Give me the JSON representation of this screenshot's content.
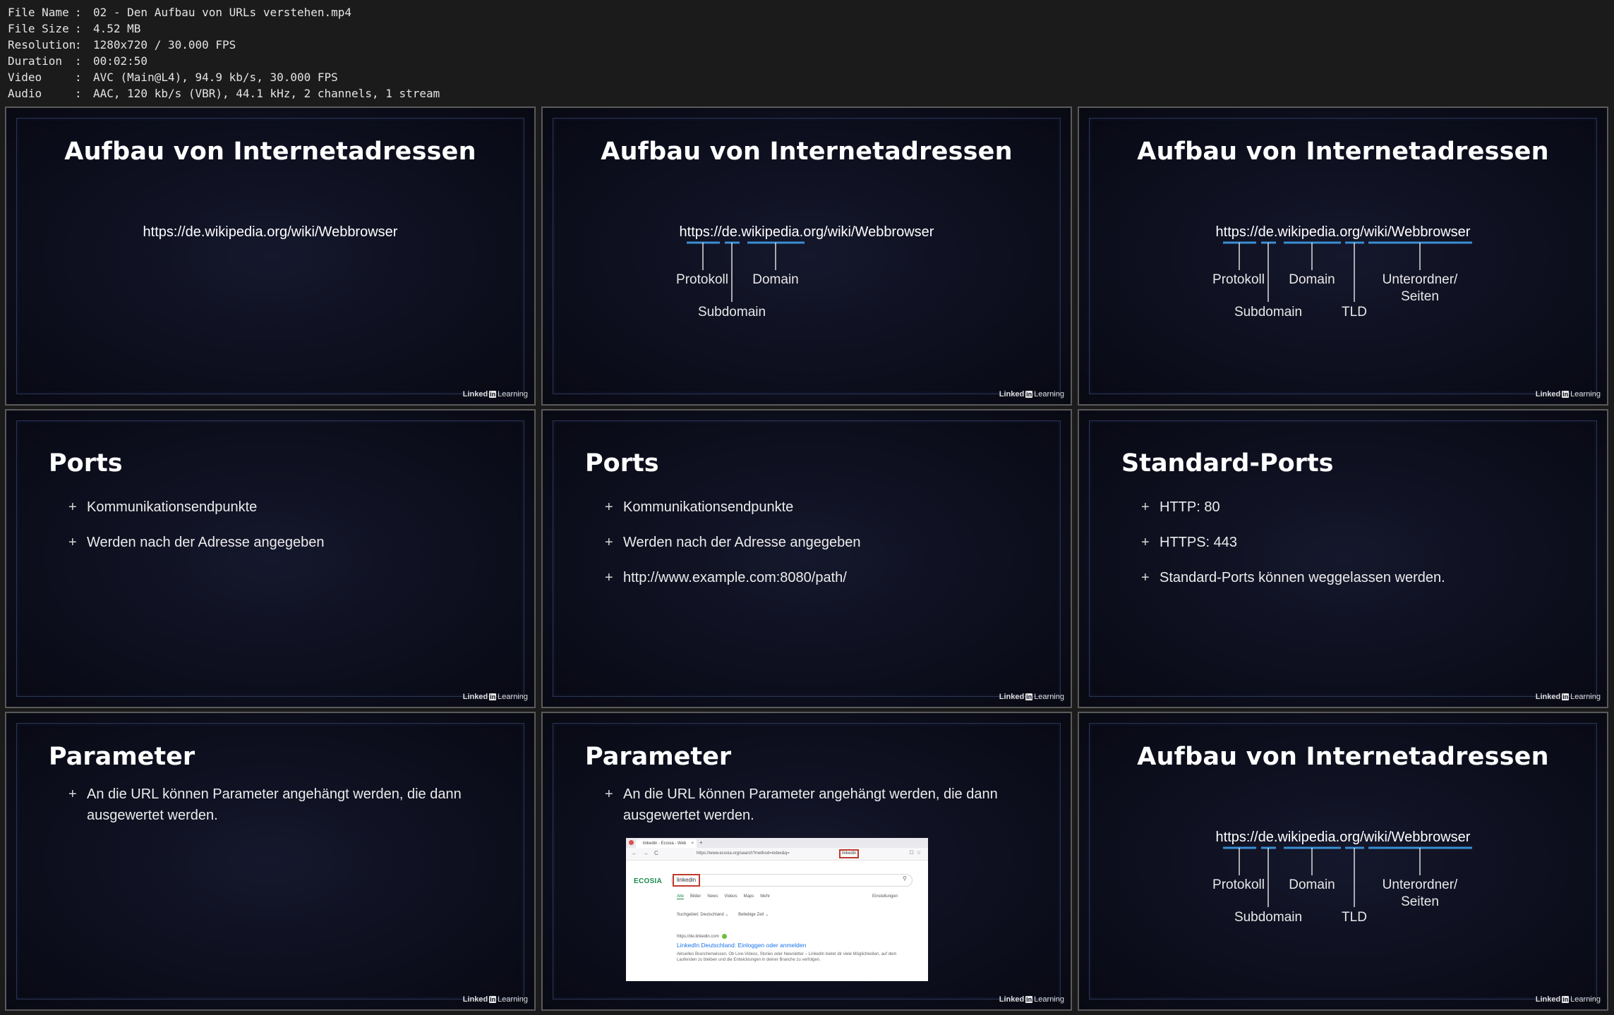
{
  "meta": [
    {
      "key": "File Name",
      "value": "02 - Den Aufbau von URLs verstehen.mp4"
    },
    {
      "key": "File Size",
      "value": "4.52 MB"
    },
    {
      "key": "Resolution",
      "value": "1280x720 / 30.000 FPS"
    },
    {
      "key": "Duration",
      "value": "00:02:50"
    },
    {
      "key": "Video",
      "value": "AVC (Main@L4), 94.9 kb/s, 30.000 FPS"
    },
    {
      "key": "Audio",
      "value": "AAC, 120 kb/s (VBR), 44.1 kHz, 2 channels, 1 stream"
    }
  ],
  "meta_separator": ":",
  "brand": {
    "part1": "Linked",
    "in": "in",
    "part2": "Learning"
  },
  "url_slide": {
    "title": "Aufbau von Internetadressen",
    "url": "https://de.wikipedia.org/wiki/Webbrowser",
    "labels": {
      "protokoll": "Protokoll",
      "subdomain": "Subdomain",
      "domain": "Domain",
      "tld": "TLD",
      "unterordner": "Unterordner/",
      "seiten": "Seiten"
    },
    "colors": {
      "underline": "#3a8fd4"
    }
  },
  "ports": {
    "title": "Ports",
    "bullets": [
      "Kommunikationsendpunkte",
      "Werden nach der Adresse angegeben",
      "http://www.example.com:8080/path/"
    ]
  },
  "standard_ports": {
    "title": "Standard-Ports",
    "bullets": [
      "HTTP: 80",
      "HTTPS: 443",
      "Standard-Ports können weggelassen werden."
    ]
  },
  "parameter": {
    "title": "Parameter",
    "bullets": [
      "An die URL können Parameter angehängt werden, die dann ausgewertet werden."
    ]
  },
  "bullet_glyph": "+",
  "ecosia_screenshot": {
    "tab_title": "linkedin - Ecosia - Web",
    "tab_close": "×",
    "new_tab": "+",
    "nav_back": "←",
    "nav_forward": "→",
    "nav_reload": "C",
    "address": "https://www.ecosia.org/search?method=index&q=",
    "address_query": "linkedin",
    "toolbar_icons": "☐☆",
    "logo": "ECOSIA",
    "search_value": "linkedin",
    "search_icon": "⚲",
    "categories": [
      "Alle",
      "Bilder",
      "News",
      "Videos",
      "Maps",
      "Mehr"
    ],
    "settings": "Einstellungen",
    "filters": [
      "Suchgebiet: Deutschland ⌄",
      "Beliebige Zeit ⌄"
    ],
    "result_url": "https://de.linkedin.com",
    "result_title": "LinkedIn Deutschland: Einloggen oder anmelden",
    "result_desc": "Aktuelles Branchenwissen, Ob Live-Videos, Stories oder Newsletter – LinkedIn bietet dir viele Möglichkeiten, auf dem Laufenden zu bleiben und die Entwicklungen in deiner Branche zu verfolgen."
  }
}
